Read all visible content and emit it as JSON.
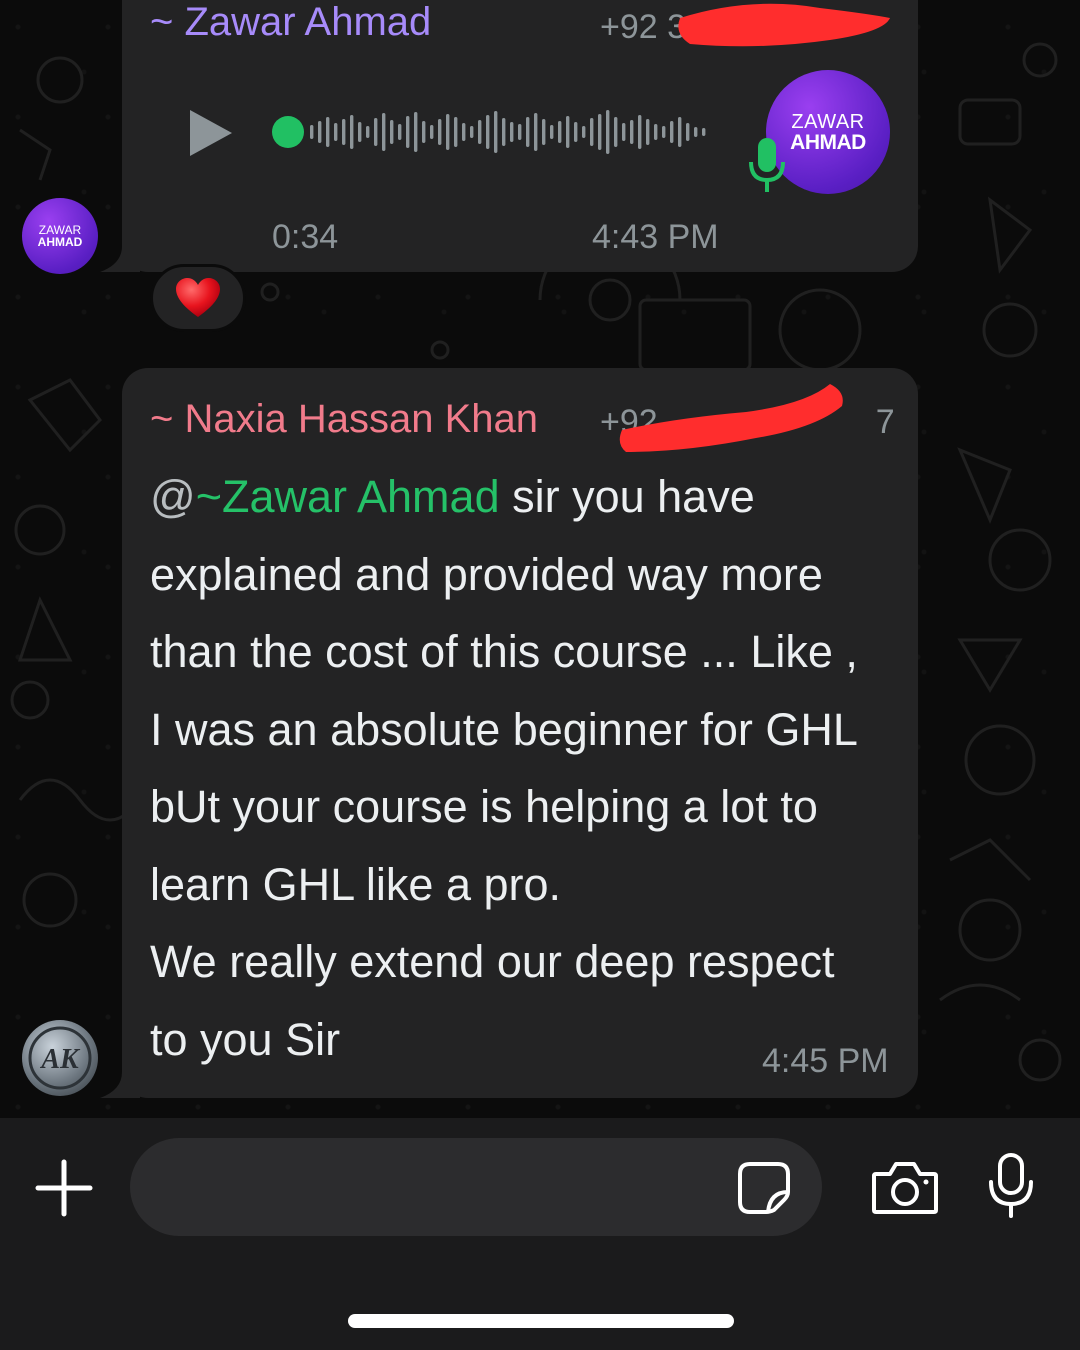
{
  "voice_message": {
    "sender_name": "~ Zawar Ahmad",
    "sender_phone": "+92 3",
    "duration": "0:34",
    "time": "4:43 PM",
    "avatar_line1": "ZAWAR",
    "avatar_line2": "AHMAD",
    "reaction": "❤️",
    "progress": 0.0
  },
  "text_message": {
    "sender_name": "~ Naxia Hassan Khan",
    "sender_phone": "+92",
    "phone_tail": "7",
    "mention_at": "@",
    "mention_name": "~Zawar Ahmad",
    "lines": [
      " sir you have",
      "explained and provided way more",
      "than the cost of this course ... Like ,",
      "I was an absolute beginner for GHL",
      "bUt your course is helping a lot to",
      "learn GHL like a pro.",
      "We really extend our deep respect",
      "to you Sir"
    ],
    "time": "4:45 PM",
    "avatar_initials": "AK"
  },
  "composer": {
    "placeholder": ""
  },
  "colors": {
    "bubble": "#232324",
    "sender1": "#a78bfa",
    "sender2": "#f17b8b",
    "mention": "#25c168",
    "accent_green": "#21c063",
    "redaction": "#ff2d2d"
  },
  "icons": [
    "play-icon",
    "mic-icon",
    "plus-icon",
    "sticker-icon",
    "camera-icon",
    "microphone-icon",
    "heart-icon"
  ]
}
